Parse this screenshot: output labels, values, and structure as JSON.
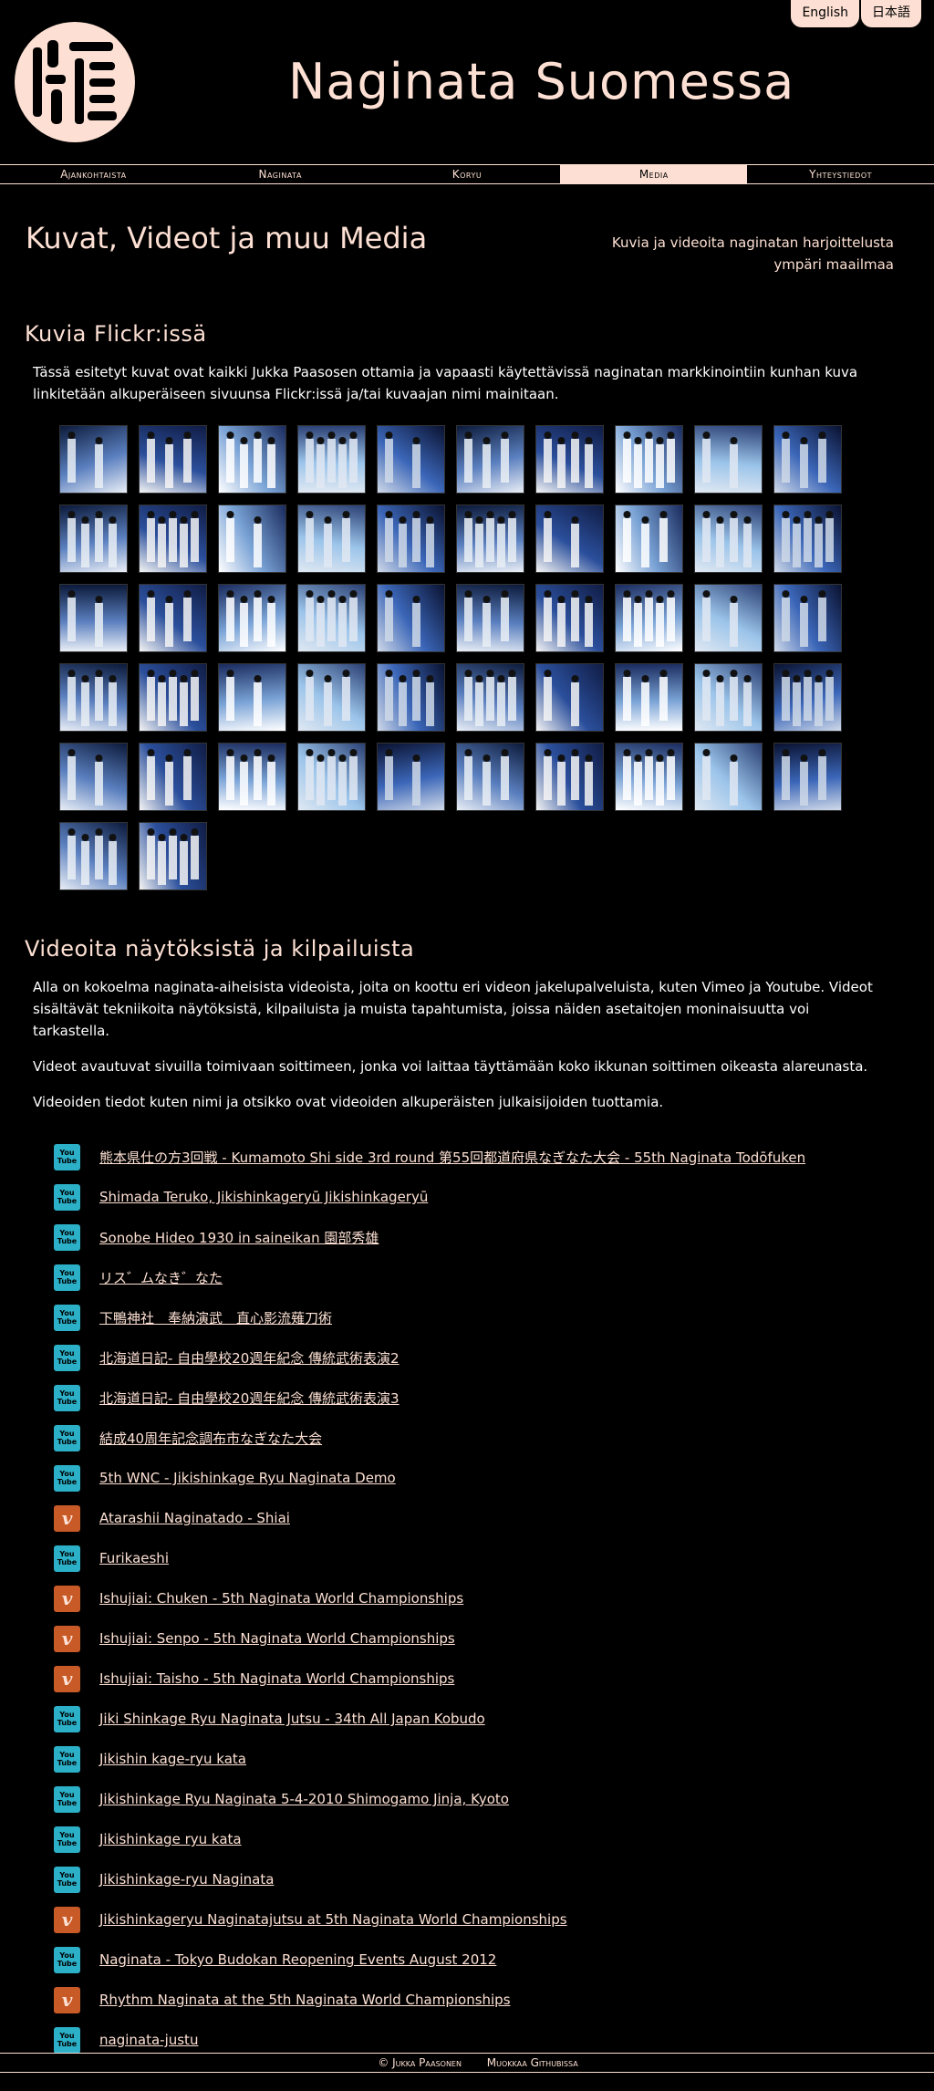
{
  "header": {
    "logo_icon": "naginata-kanji-logo",
    "title": "Naginata Suomessa",
    "languages": [
      "English",
      "日本語"
    ]
  },
  "nav": [
    {
      "label": "Ajankohtaista",
      "active": false
    },
    {
      "label": "Naginata",
      "active": false
    },
    {
      "label": "Koryu",
      "active": false
    },
    {
      "label": "Media",
      "active": true
    },
    {
      "label": "Yhteystiedot",
      "active": false
    }
  ],
  "page": {
    "title": "Kuvat, Videot ja muu Media",
    "subtitle": "Kuvia ja videoita naginatan harjoittelusta ympäri maailmaa"
  },
  "flickr": {
    "heading": "Kuvia Flickr:issä",
    "text": "Tässä esitetyt kuvat ovat kaikki Jukka Paasosen ottamia ja vapaasti käytettävissä naginatan markkinointiin kunhan kuva linkitetään alkuperäiseen sivuunsa Flickr:issä ja/tai kuvaajan nimi mainitaan.",
    "thumbnail_count": 52
  },
  "videos": {
    "heading": "Videoita näytöksistä ja kilpailuista",
    "paragraphs": [
      "Alla on kokoelma naginata-aiheisista videoista, joita on koottu eri videon jakelupalveluista, kuten Vimeo ja Youtube. Videot sisältävät tekniikoita näytöksistä, kilpailuista ja muista tapahtumista, joissa näiden asetaitojen moninaisuutta voi tarkastella.",
      "Videot avautuvat sivuilla toimivaan soittimeen, jonka voi laittaa täyttämään koko ikkunan soittimen oikeasta alareunasta.",
      "Videoiden tiedot kuten nimi ja otsikko ovat videoiden alkuperäisten julkaisijoiden tuottamia."
    ],
    "items": [
      {
        "service": "youtube",
        "title": "熊本県仕の方3回戦 - Kumamoto Shi side 3rd round 第55回都道府県なぎなた大会 - 55th Naginata Todōfuken"
      },
      {
        "service": "youtube",
        "title": "Shimada Teruko, Jikishinkageryū Jikishinkageryū"
      },
      {
        "service": "youtube",
        "title": "Sonobe Hideo 1930 in saineikan 園部秀雄"
      },
      {
        "service": "youtube",
        "title": "リス゛ムなき゛なた"
      },
      {
        "service": "youtube",
        "title": "下鴨神社　奉納演武　直心影流薙刀術"
      },
      {
        "service": "youtube",
        "title": "北海道日記- 自由學校20週年紀念 傳統武術表演2"
      },
      {
        "service": "youtube",
        "title": "北海道日記- 自由學校20週年紀念 傳統武術表演3"
      },
      {
        "service": "youtube",
        "title": "結成40周年記念調布市なぎなた大会"
      },
      {
        "service": "youtube",
        "title": "5th WNC - Jikishinkage Ryu Naginata Demo"
      },
      {
        "service": "vimeo",
        "title": "Atarashii Naginatado - Shiai"
      },
      {
        "service": "youtube",
        "title": "Furikaeshi"
      },
      {
        "service": "vimeo",
        "title": "Ishujiai: Chuken - 5th Naginata World Championships"
      },
      {
        "service": "vimeo",
        "title": "Ishujiai: Senpo - 5th Naginata World Championships"
      },
      {
        "service": "vimeo",
        "title": "Ishujiai: Taisho - 5th Naginata World Championships"
      },
      {
        "service": "youtube",
        "title": "Jiki Shinkage Ryu Naginata Jutsu - 34th All Japan Kobudo"
      },
      {
        "service": "youtube",
        "title": "Jikishin kage-ryu kata"
      },
      {
        "service": "youtube",
        "title": "Jikishinkage Ryu Naginata 5-4-2010 Shimogamo Jinja, Kyoto"
      },
      {
        "service": "youtube",
        "title": "Jikishinkage ryu kata"
      },
      {
        "service": "youtube",
        "title": "Jikishinkage-ryu Naginata"
      },
      {
        "service": "vimeo",
        "title": "Jikishinkageryu Naginatajutsu at 5th Naginata World Championships"
      },
      {
        "service": "youtube",
        "title": "Naginata - Tokyo Budokan Reopening Events August 2012"
      },
      {
        "service": "vimeo",
        "title": "Rhythm Naginata at the 5th Naginata World Championships"
      },
      {
        "service": "youtube",
        "title": "naginata-justu"
      }
    ]
  },
  "footer": {
    "copyright": "© Jukka Paasonen",
    "edit": "Muokkaa Githubissa"
  },
  "colors": {
    "accent": "#fde0d3",
    "background": "#000000",
    "youtube": "#2bb0c7",
    "vimeo": "#c75a26"
  }
}
